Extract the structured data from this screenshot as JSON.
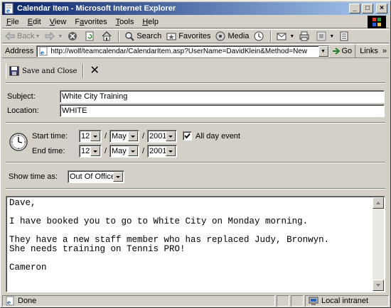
{
  "window": {
    "title": "Calendar Item - Microsoft Internet Explorer",
    "minimize": "_",
    "maximize": "□",
    "close": "×"
  },
  "menu": {
    "items": [
      {
        "accel": "F",
        "rest": "ile"
      },
      {
        "accel": "E",
        "rest": "dit"
      },
      {
        "accel": "V",
        "rest": "iew"
      },
      {
        "accel": "",
        "pre": "F",
        "accel2": "a",
        "rest": "vorites"
      },
      {
        "accel": "T",
        "rest": "ools"
      },
      {
        "accel": "H",
        "rest": "elp"
      }
    ],
    "labels": [
      "File",
      "Edit",
      "View",
      "Favorites",
      "Tools",
      "Help"
    ]
  },
  "toolbar": {
    "back": "Back",
    "search": "Search",
    "favorites": "Favorites",
    "media": "Media"
  },
  "address": {
    "label": "Address",
    "url": "http://wolf/teamcalendar/CalendarItem.asp?UserName=DavidKlein&Method=New",
    "go": "Go",
    "links": "Links"
  },
  "form": {
    "save_close": "Save and Close",
    "close_x": "✕",
    "subject_label": "Subject:",
    "subject_value": "White City Training",
    "location_label": "Location:",
    "location_value": "WHITE",
    "start_label": "Start time:",
    "end_label": "End time:",
    "start": {
      "day": "12",
      "month": "May",
      "year": "2001"
    },
    "end": {
      "day": "12",
      "month": "May",
      "year": "2001"
    },
    "slash": "/",
    "all_day_label": "All day event",
    "all_day_checked": true,
    "show_time_label": "Show time as:",
    "show_time_value": "Out Of Office",
    "message": "Dave,\n\nI have booked you to go to White City on Monday morning.\n\nThey have a new staff member who has replaced Judy, Bronwyn.\nShe needs training on Tennis PRO!\n\nCameron"
  },
  "status": {
    "text": "Done",
    "zone": "Local intranet"
  },
  "colors": {
    "titlebar_start": "#0a246a",
    "titlebar_end": "#a6caf0",
    "face": "#d4d0c8"
  }
}
